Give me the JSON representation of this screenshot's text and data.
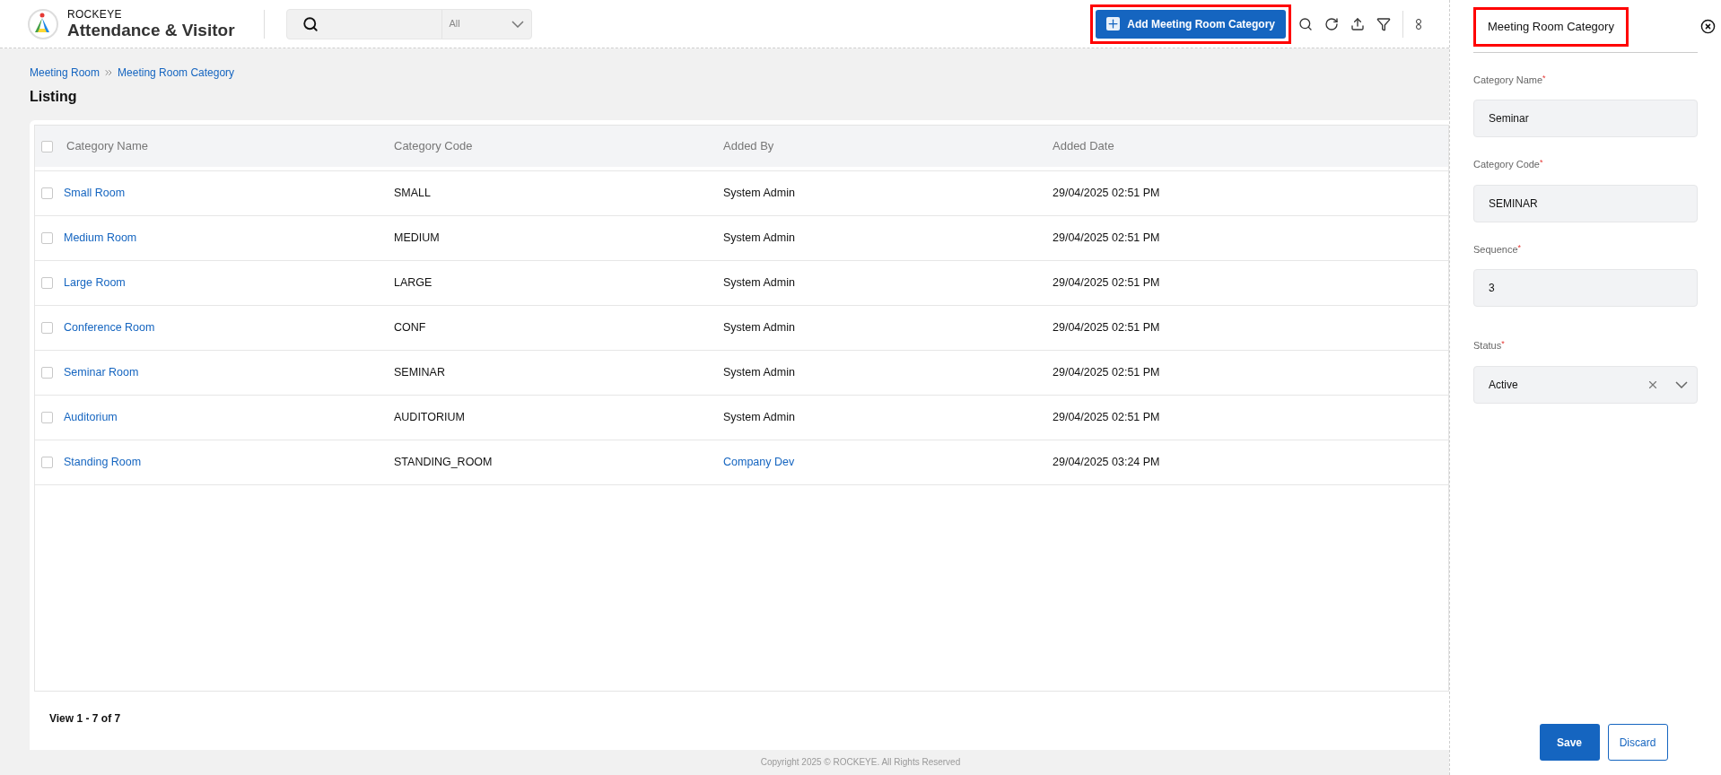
{
  "brand": {
    "company": "ROCKEYE",
    "product": "Attendance & Visitor"
  },
  "search": {
    "scope": "All"
  },
  "toolbar": {
    "add_button": "Add Meeting Room Category",
    "highlighted": true
  },
  "breadcrumb": [
    {
      "label": "Meeting Room"
    },
    {
      "label": "Meeting Room Category"
    }
  ],
  "page_title": "Listing",
  "table": {
    "select_all_checked": false,
    "columns": [
      "Category Name",
      "Category Code",
      "Added By",
      "Added Date"
    ],
    "rows": [
      {
        "checked": false,
        "name": "Small Room",
        "code": "SMALL",
        "added_by": {
          "text": "System Admin",
          "link": false
        },
        "date": "29/04/2025 02:51 PM"
      },
      {
        "checked": false,
        "name": "Medium Room",
        "code": "MEDIUM",
        "added_by": {
          "text": "System Admin",
          "link": false
        },
        "date": "29/04/2025 02:51 PM"
      },
      {
        "checked": false,
        "name": "Large Room",
        "code": "LARGE",
        "added_by": {
          "text": "System Admin",
          "link": false
        },
        "date": "29/04/2025 02:51 PM"
      },
      {
        "checked": false,
        "name": "Conference Room",
        "code": "CONF",
        "added_by": {
          "text": "System Admin",
          "link": false
        },
        "date": "29/04/2025 02:51 PM"
      },
      {
        "checked": false,
        "name": "Seminar Room",
        "code": "SEMINAR",
        "added_by": {
          "text": "System Admin",
          "link": false
        },
        "date": "29/04/2025 02:51 PM"
      },
      {
        "checked": false,
        "name": "Auditorium",
        "code": "AUDITORIUM",
        "added_by": {
          "text": "System Admin",
          "link": false
        },
        "date": "29/04/2025 02:51 PM"
      },
      {
        "checked": false,
        "name": "Standing Room",
        "code": "STANDING_ROOM",
        "added_by": {
          "text": "Company Dev",
          "link": true
        },
        "date": "29/04/2025 03:24 PM"
      }
    ],
    "pagination": "View 1 - 7 of 7"
  },
  "copyright": "Copyright 2025 © ROCKEYE. All Rights Reserved",
  "panel": {
    "title": "Meeting Room Category",
    "highlighted": true,
    "fields": [
      {
        "kind": "text",
        "label": "Category Name",
        "required_mark": "*",
        "value": "Seminar"
      },
      {
        "kind": "text",
        "label": "Category Code",
        "required_mark": "*",
        "value": "SEMINAR"
      },
      {
        "kind": "text",
        "label": "Sequence",
        "required_mark": "*",
        "value": "3"
      },
      {
        "kind": "select",
        "label": "Status",
        "required_mark": "*",
        "value": "Active"
      }
    ],
    "buttons": [
      {
        "kind": "primary",
        "label": "Save"
      },
      {
        "kind": "secondary",
        "label": "Discard"
      }
    ]
  }
}
